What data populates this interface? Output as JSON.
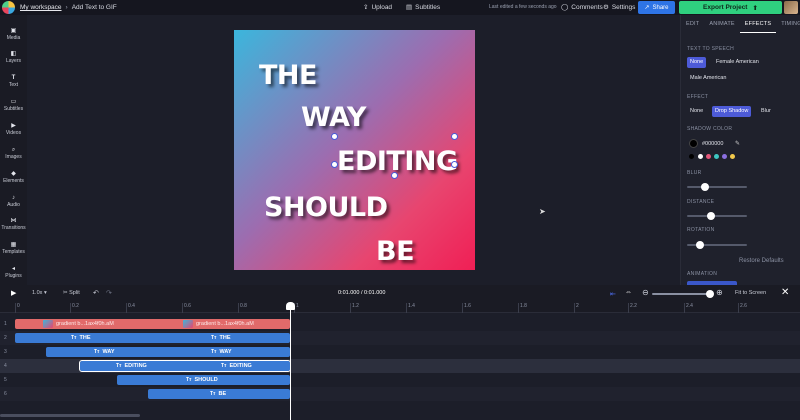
{
  "topbar": {
    "workspace": "My workspace",
    "page_title": "Add Text to GIF",
    "upload": "Upload",
    "subtitles": "Subtitles",
    "last_edited": "Last edited a few seconds ago",
    "comments": "Comments",
    "settings": "Settings",
    "share": "Share",
    "export": "Export Project"
  },
  "sidebar": {
    "items": [
      {
        "label": "Media",
        "icon": "media-icon"
      },
      {
        "label": "Layers",
        "icon": "layers-icon"
      },
      {
        "label": "Text",
        "icon": "text-icon"
      },
      {
        "label": "Subtitles",
        "icon": "subtitles-icon"
      },
      {
        "label": "Videos",
        "icon": "videos-icon"
      },
      {
        "label": "Images",
        "icon": "images-icon"
      },
      {
        "label": "Elements",
        "icon": "elements-icon"
      },
      {
        "label": "Audio",
        "icon": "audio-icon"
      },
      {
        "label": "Transitions",
        "icon": "transitions-icon"
      },
      {
        "label": "Templates",
        "icon": "templates-icon"
      },
      {
        "label": "Plugins",
        "icon": "plugins-icon"
      }
    ]
  },
  "canvas": {
    "words": [
      "THE",
      "WAY",
      "EDITING",
      "SHOULD",
      "BE"
    ],
    "colors": {
      "gradient_start": "#3bb6dc",
      "gradient_end": "#f01f55"
    }
  },
  "panel": {
    "tabs": [
      "EDIT",
      "ANIMATE",
      "EFFECTS",
      "TIMING"
    ],
    "active_tab": "EFFECTS",
    "tts_label": "TEXT TO SPEECH",
    "tts_options": [
      "None",
      "Female American",
      "Male American"
    ],
    "tts_selected": "None",
    "effect_label": "EFFECT",
    "effect_options": [
      "None",
      "Drop Shadow",
      "Blur"
    ],
    "effect_selected": "Drop Shadow",
    "shadow_color_label": "SHADOW COLOR",
    "shadow_color": "#000000",
    "preset_colors": [
      "#000000",
      "#ffffff",
      "#e4567a",
      "#3ec6c1",
      "#8b6fe0",
      "#f2c94c"
    ],
    "blur_label": "BLUR",
    "blur_value": 0.3,
    "distance_label": "DISTANCE",
    "distance_value": 0.35,
    "rotation_label": "ROTATION",
    "rotation_value": 0.2,
    "restore": "Restore Defaults",
    "animation_label": "ANIMATION"
  },
  "timeline": {
    "speed": "1.0x",
    "split": "Split",
    "time_current": "0:01.000",
    "time_total": "0:01.000",
    "fit": "Fit to Screen",
    "ruler": [
      "0",
      "0.2",
      "0.4",
      "0.6",
      "0.8",
      "1",
      "1.2",
      "1.4",
      "1.6",
      "1.8",
      "2",
      "2.2",
      "2.4",
      "2.6"
    ],
    "tracks": [
      {
        "num": "1",
        "kind": "media",
        "label": "gradient b...1ax4f0h.aM"
      },
      {
        "num": "2",
        "kind": "text",
        "label": "THE"
      },
      {
        "num": "3",
        "kind": "text",
        "label": "WAY"
      },
      {
        "num": "4",
        "kind": "text",
        "label": "EDITING"
      },
      {
        "num": "5",
        "kind": "text",
        "label": "SHOULD"
      },
      {
        "num": "6",
        "kind": "text",
        "label": "BE"
      }
    ]
  }
}
